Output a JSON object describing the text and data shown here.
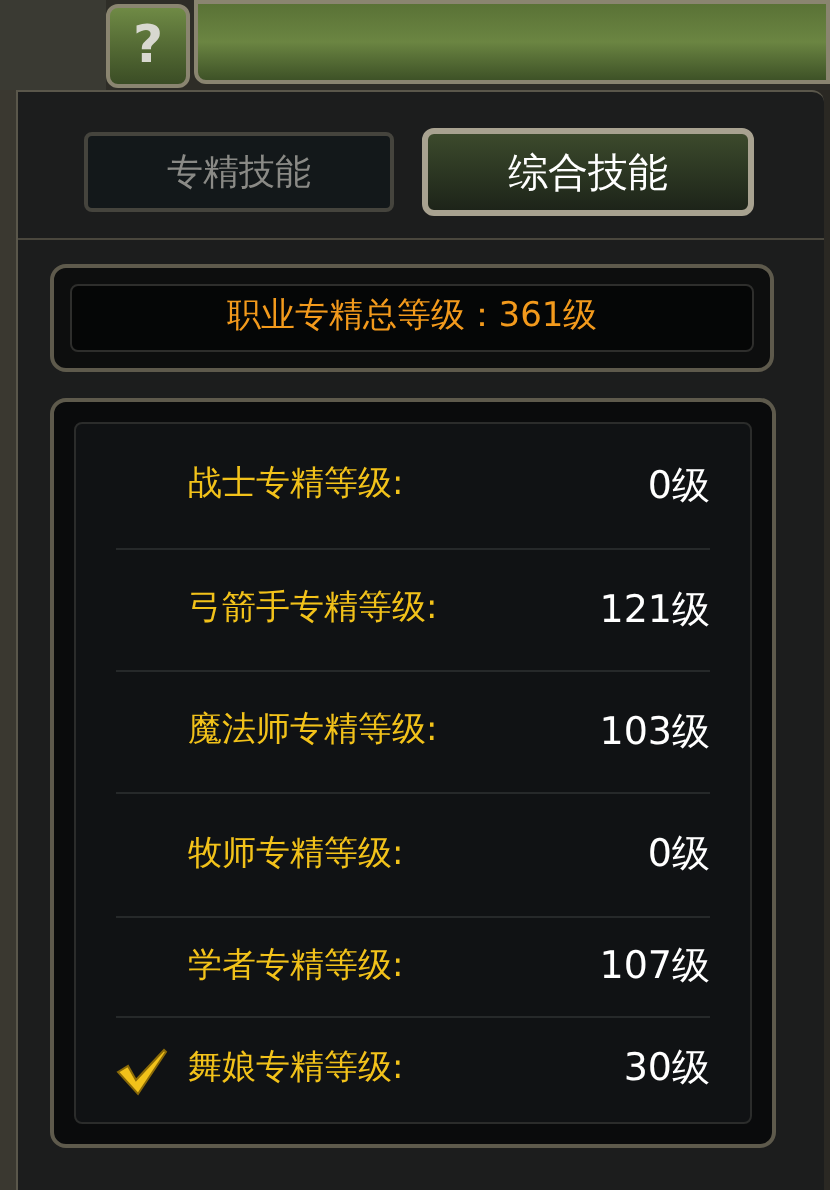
{
  "help_button": {
    "label": "?"
  },
  "tabs": [
    {
      "label": "专精技能",
      "selected": false
    },
    {
      "label": "综合技能",
      "selected": true
    }
  ],
  "total": "职业专精总等级：361级",
  "rows": [
    {
      "label": "战士专精等级:",
      "value": "0级",
      "checked": false
    },
    {
      "label": "弓箭手专精等级:",
      "value": "121级",
      "checked": false
    },
    {
      "label": "魔法师专精等级:",
      "value": "103级",
      "checked": false
    },
    {
      "label": "牧师专精等级:",
      "value": "0级",
      "checked": false
    },
    {
      "label": "学者专精等级:",
      "value": "107级",
      "checked": false
    },
    {
      "label": "舞娘专精等级:",
      "value": "30级",
      "checked": true
    }
  ]
}
